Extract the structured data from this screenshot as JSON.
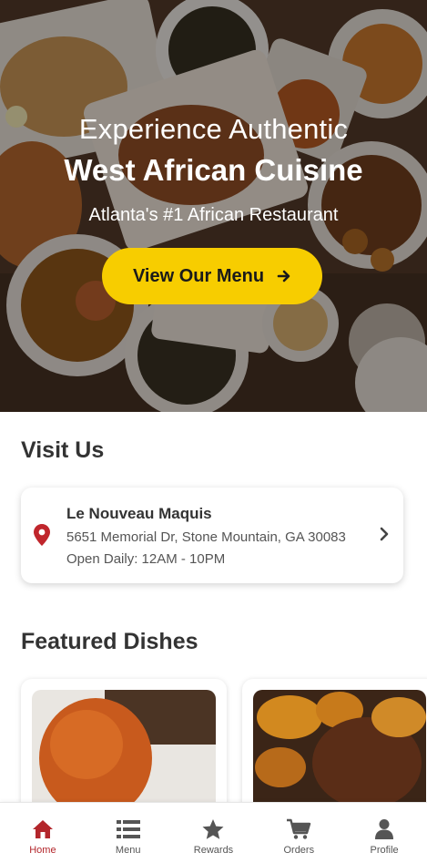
{
  "hero": {
    "line1": "Experience Authentic",
    "line2": "West African Cuisine",
    "line3": "Atlanta's #1 African Restaurant",
    "cta_label": "View Our Menu"
  },
  "visit": {
    "title": "Visit Us",
    "name": "Le Nouveau Maquis",
    "address": "5651 Memorial Dr, Stone Mountain, GA 30083",
    "hours": "Open Daily: 12AM - 10PM"
  },
  "featured": {
    "title": "Featured Dishes"
  },
  "nav": [
    {
      "label": "Home",
      "icon": "home-icon",
      "active": true
    },
    {
      "label": "Menu",
      "icon": "list-icon",
      "active": false
    },
    {
      "label": "Rewards",
      "icon": "star-icon",
      "active": false
    },
    {
      "label": "Orders",
      "icon": "cart-icon",
      "active": false
    },
    {
      "label": "Profile",
      "icon": "user-icon",
      "active": false
    }
  ],
  "colors": {
    "accent": "#f7cd00",
    "brand_red": "#b3262b",
    "pin_red": "#c0262c"
  }
}
